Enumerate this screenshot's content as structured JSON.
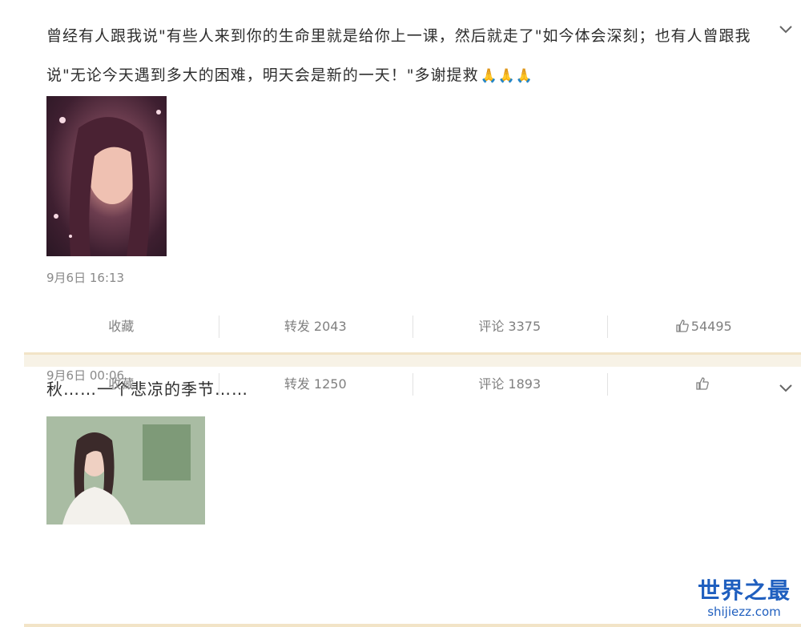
{
  "posts": [
    {
      "text": "曾经有人跟我说\"有些人来到你的生命里就是给你上一课，然后就走了\"如今体会深刻；也有人曾跟我说\"无论今天遇到多大的困难，明天会是新的一天！\"多谢提救",
      "emoji": "🙏🙏🙏",
      "timestamp": "9月6日 16:13",
      "actions": {
        "favorite": "收藏",
        "repost": "转发 2043",
        "comment": "评论 3375",
        "like": "54495"
      }
    },
    {
      "text": "秋……一个悲凉的季节……",
      "emoji": "",
      "timestamp": "9月6日 00:06",
      "actions": {
        "favorite": "收藏",
        "repost": "转发 1250",
        "comment": "评论 1893",
        "like": ""
      }
    }
  ],
  "watermark": {
    "title": "世界之最",
    "url": "shijiezz.com"
  },
  "colors": {
    "separator": "#f7f2e6",
    "watermark": "#1f5fbf",
    "muted_text": "#808080"
  },
  "icons": {
    "menu": "chevron-down-icon",
    "like": "thumbs-up-icon"
  }
}
